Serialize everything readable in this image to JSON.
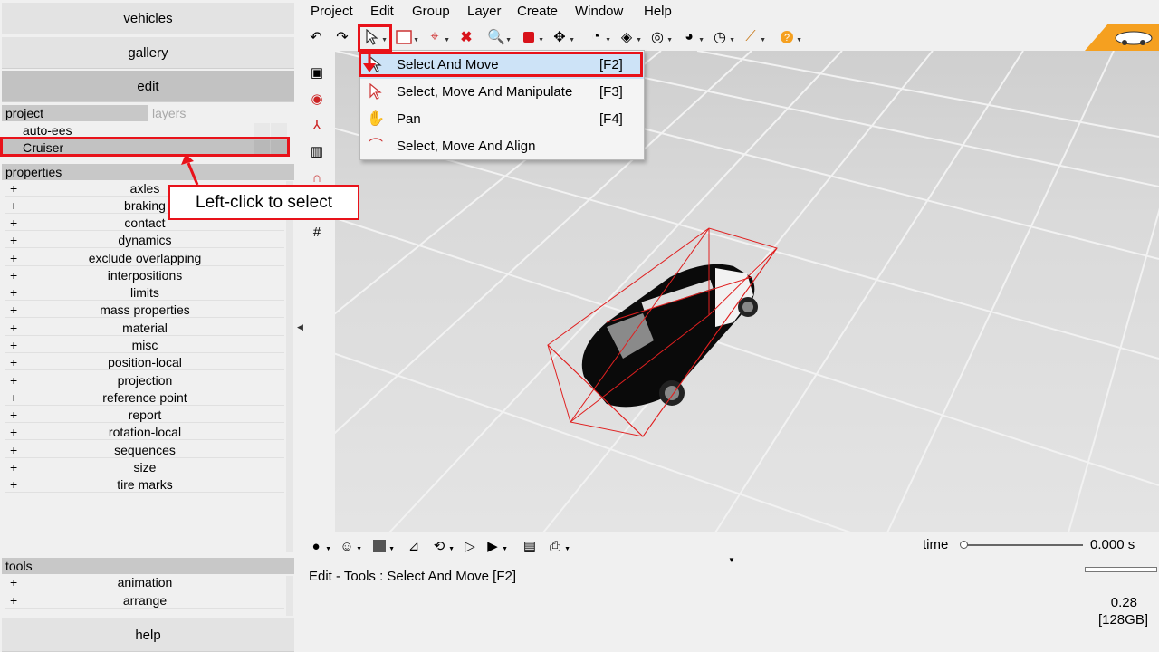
{
  "nav": {
    "vehicles": "vehicles",
    "gallery": "gallery",
    "edit": "edit",
    "help": "help"
  },
  "project_panel": {
    "tab_project": "project",
    "tab_layers": "layers",
    "items": [
      "auto-ees",
      "Cruiser"
    ]
  },
  "properties": {
    "header": "properties",
    "plus": "+",
    "items": [
      "axles",
      "braking",
      "contact",
      "dynamics",
      "exclude overlapping",
      "interpositions",
      "limits",
      "mass properties",
      "material",
      "misc",
      "position-local",
      "projection",
      "reference point",
      "report",
      "rotation-local",
      "sequences",
      "size",
      "tire marks"
    ]
  },
  "tools": {
    "header": "tools",
    "items": [
      "animation",
      "arrange"
    ]
  },
  "menubar": [
    "Project",
    "Edit",
    "Group",
    "Layer",
    "Create",
    "Window",
    "Help"
  ],
  "dropdown": {
    "items": [
      {
        "label": "Select And Move",
        "key": "[F2]",
        "icon": "select-arrow-icon"
      },
      {
        "label": "Select, Move And Manipulate",
        "key": "[F3]",
        "icon": "manipulate-arrow-icon"
      },
      {
        "label": "Pan",
        "key": "[F4]",
        "icon": "hand-icon"
      },
      {
        "label": "Select, Move And Align",
        "key": "",
        "icon": "align-icon"
      }
    ]
  },
  "callout": "Left-click to select",
  "time": {
    "label": "time",
    "value": "0.000 s",
    "position": 0
  },
  "status_text": "Edit - Tools : Select And Move [F2]",
  "memory": {
    "value": "0.28",
    "capacity": "[128GB]"
  },
  "colors": {
    "annotation_red": "#e8121a",
    "logo_orange": "#f5a020"
  }
}
